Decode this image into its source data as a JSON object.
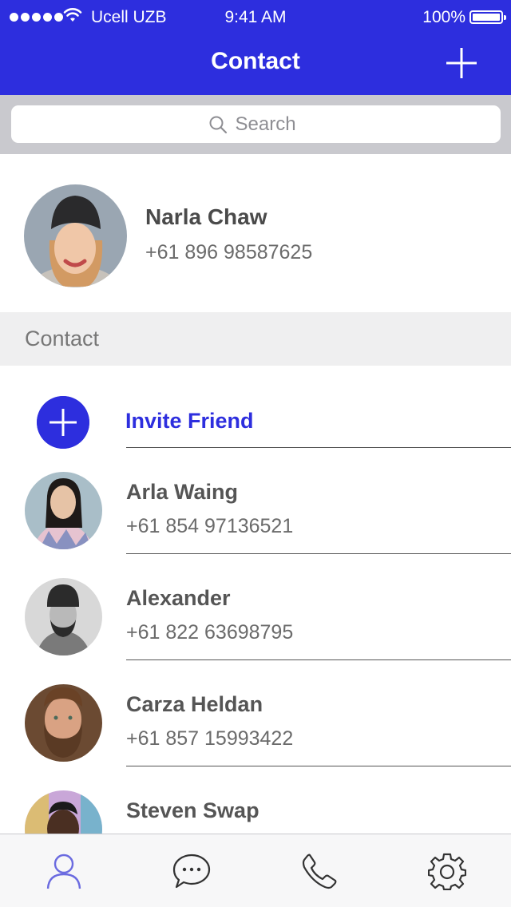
{
  "status_bar": {
    "carrier": "Ucell UZB",
    "time": "9:41 AM",
    "battery": "100%"
  },
  "header": {
    "title": "Contact",
    "add_icon": "plus-icon"
  },
  "search": {
    "placeholder": "Search",
    "icon": "search-icon"
  },
  "profile": {
    "name": "Narla Chaw",
    "phone": "+61 896 98587625"
  },
  "section": {
    "title": "Contact"
  },
  "invite": {
    "label": "Invite Friend",
    "icon": "plus-icon"
  },
  "contacts": [
    {
      "name": "Arla Waing",
      "phone": "+61 854 97136521"
    },
    {
      "name": "Alexander",
      "phone": "+61 822 63698795"
    },
    {
      "name": "Carza Heldan",
      "phone": "+61 857 15993422"
    },
    {
      "name": "Steven Swap",
      "phone": ""
    }
  ],
  "tabs": [
    {
      "icon": "person-icon",
      "active": true
    },
    {
      "icon": "chat-bubble-icon",
      "active": false
    },
    {
      "icon": "phone-icon",
      "active": false
    },
    {
      "icon": "gear-icon",
      "active": false
    }
  ],
  "colors": {
    "accent": "#2d2ede",
    "tab_active": "#6b6be0",
    "tab_inactive": "#333333"
  }
}
